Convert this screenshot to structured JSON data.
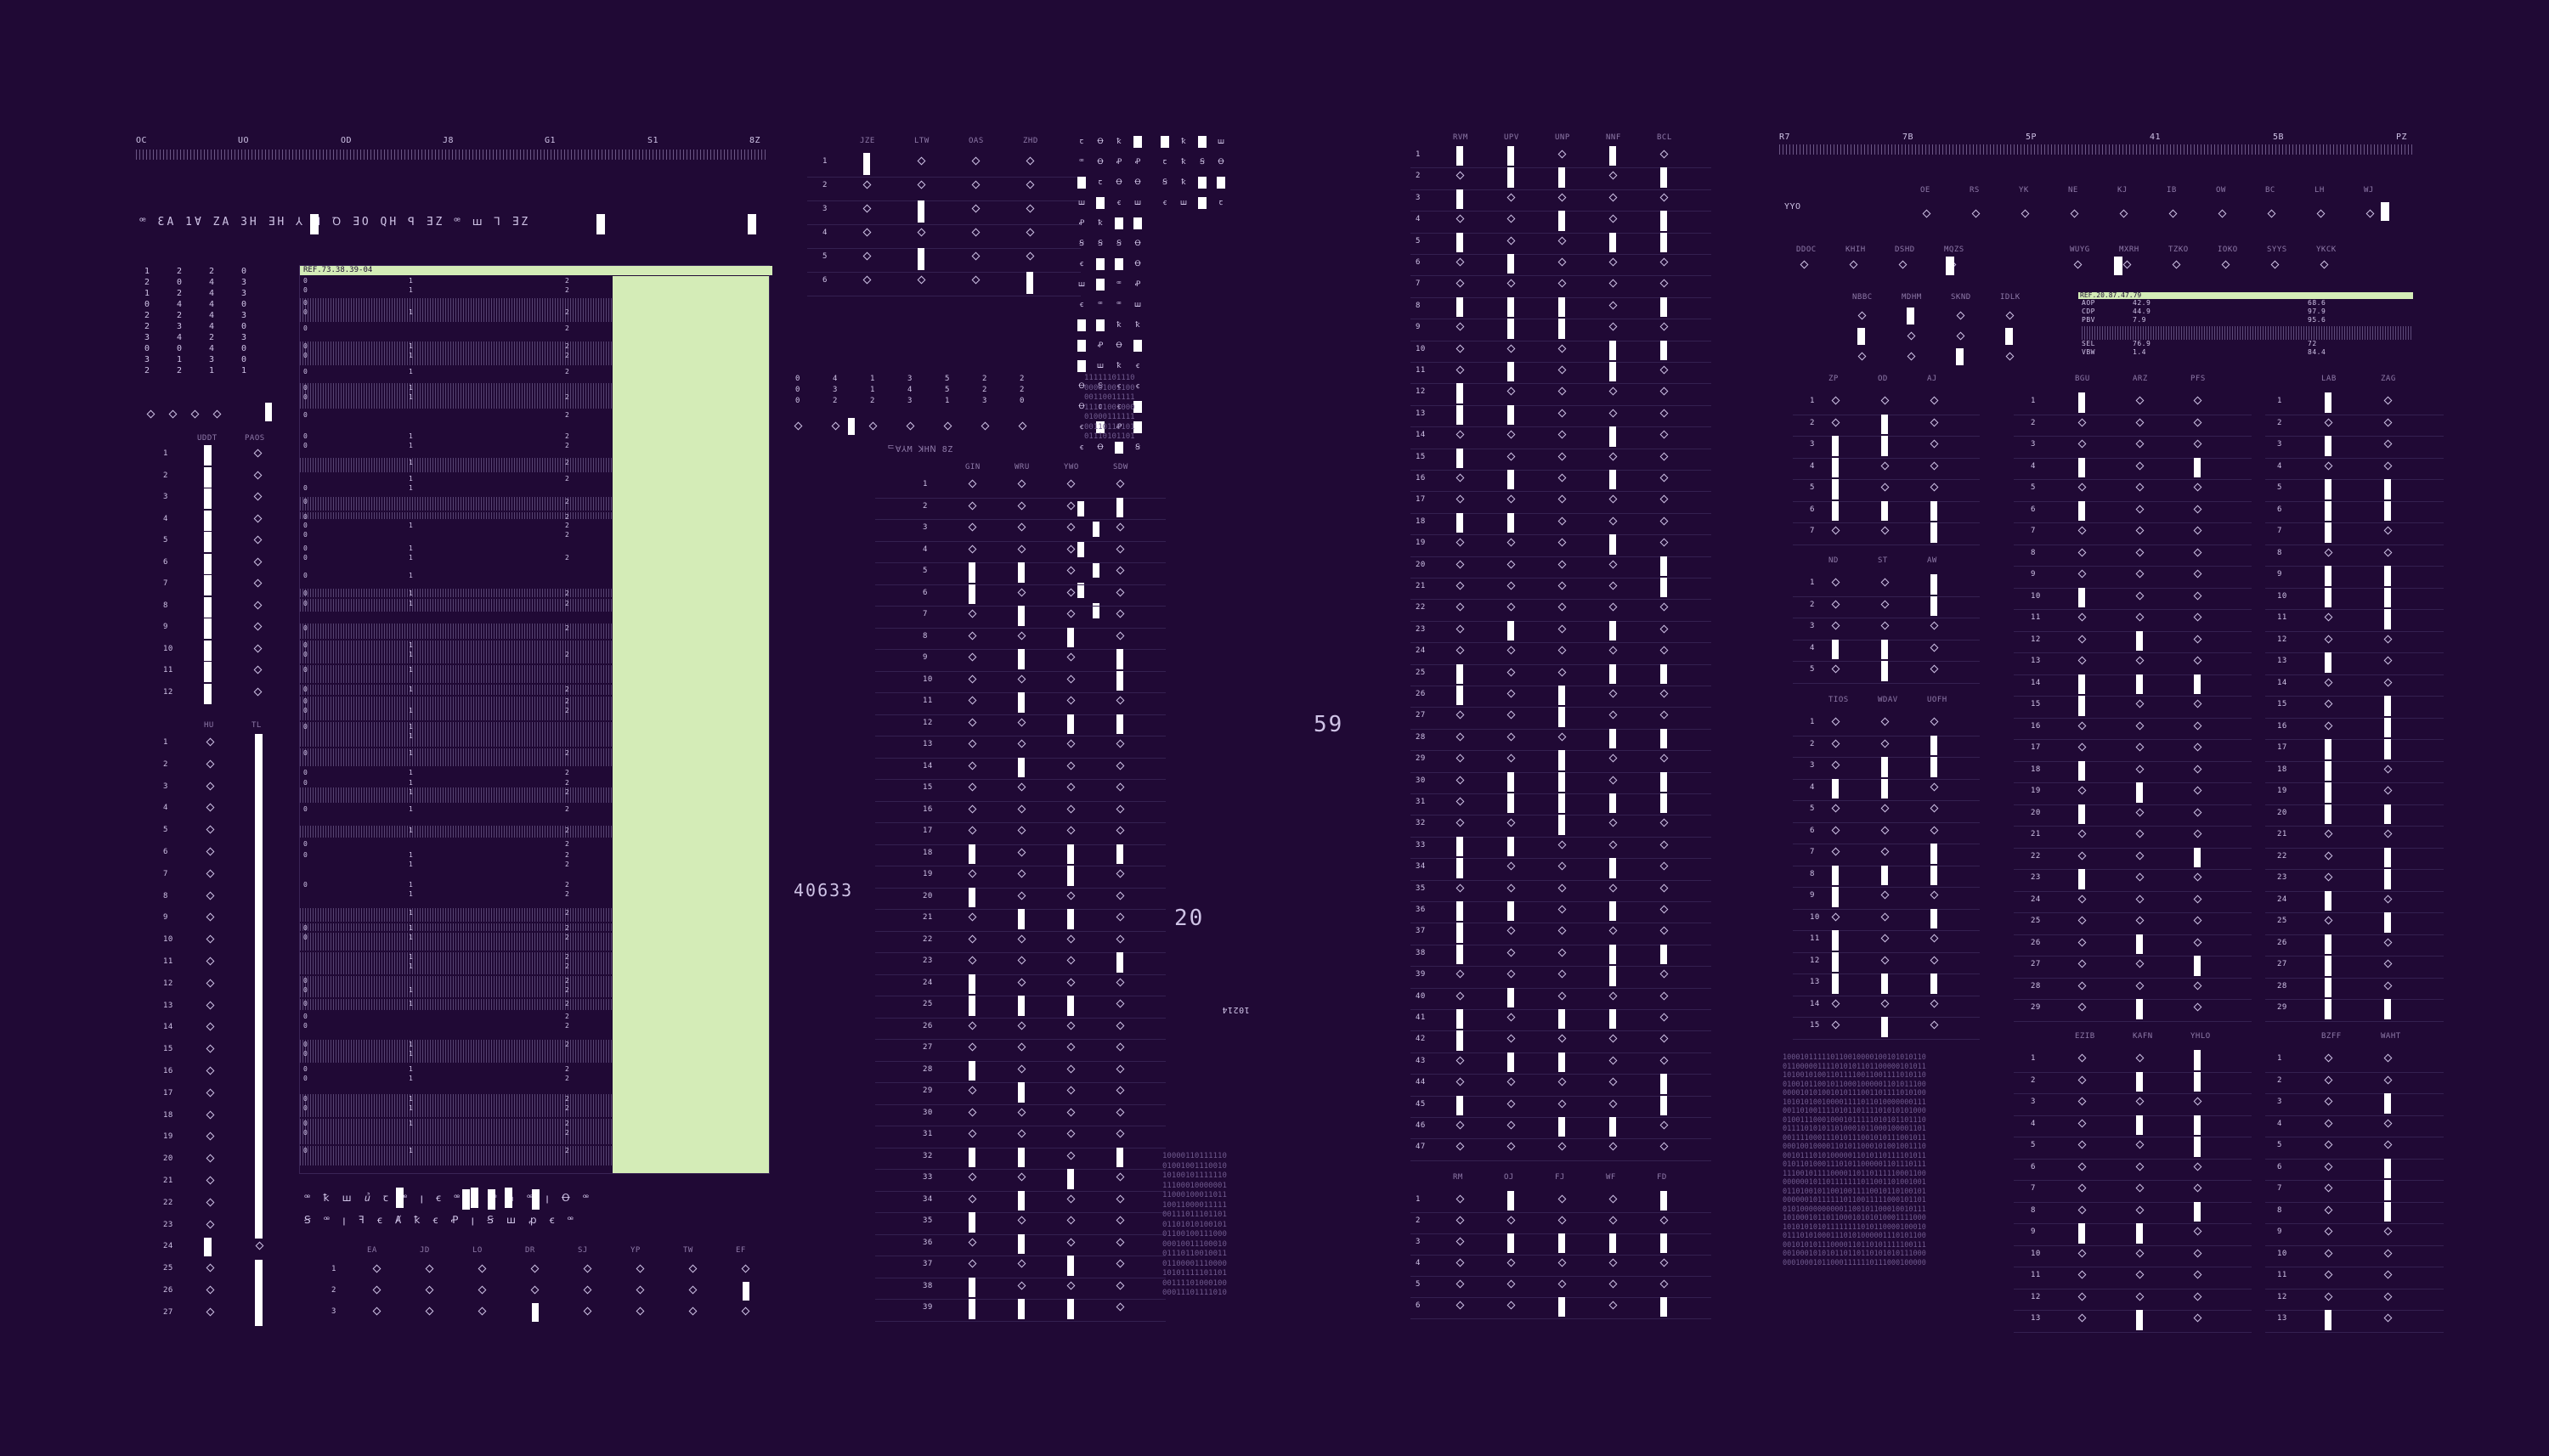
{
  "colors": {
    "background": "#200935",
    "text": "#cfc3e6",
    "accent": "#d4ecb7",
    "bar": "#ffffff",
    "dim": "#8e7aa8"
  },
  "counters": {
    "primary": "59",
    "secondary": "40633",
    "tertiary": "20",
    "small": "10214"
  },
  "top_ruler_left": {
    "labels": [
      "OC",
      "UO",
      "OD",
      "J8",
      "G1",
      "S1",
      "8Z"
    ]
  },
  "top_ruler_right": {
    "labels": [
      "R7",
      "7B",
      "5P",
      "41",
      "5B",
      "PZ"
    ]
  },
  "glyph_strip_top": "ꟹ ƐA 1Ɐ ZA 3H ƎH ⅄ ꟻ Ꝺ ƎO QH ꟼ ƎZ ꟹ ꟺ Ꞁ ƎZ",
  "glyph_strip_bottom_1": "ꟹ ꝁ ꟺ ꞿ ꞇ ꟹ ꞁ ꞓ ꟹ ꞓ ꟹ ꝇ ꟹ ꞁ Ꝋ ꟹ",
  "glyph_strip_bottom_2": "Ꞩ ꟹ ꞁ ꟻ ꞓ Ⱥ ꝁ ꞓ Ꝓ ꞁ Ꞩ ꟺ ꝓ ꞓ ꟹ",
  "matrix_left": {
    "rows": [
      [
        "1",
        "2",
        "2",
        "0"
      ],
      [
        "2",
        "0",
        "4",
        "3"
      ],
      [
        "1",
        "2",
        "4",
        "3"
      ],
      [
        "0",
        "4",
        "4",
        "0"
      ],
      [
        "2",
        "2",
        "4",
        "3"
      ],
      [
        "2",
        "3",
        "4",
        "0"
      ],
      [
        "3",
        "4",
        "2",
        "3"
      ],
      [
        "0",
        "0",
        "4",
        "0"
      ],
      [
        "3",
        "1",
        "3",
        "0"
      ],
      [
        "2",
        "2",
        "1",
        "1"
      ]
    ]
  },
  "panel_left_a": {
    "headers": [
      "UDDT",
      "PAOS"
    ],
    "rows": [
      "1",
      "2",
      "3",
      "4",
      "5",
      "6",
      "7",
      "8",
      "9",
      "10",
      "11",
      "12"
    ]
  },
  "panel_left_b": {
    "headers": [
      "HU",
      "TL"
    ],
    "rows": [
      "1",
      "2",
      "3",
      "4",
      "5",
      "6",
      "7",
      "8",
      "9",
      "10",
      "11",
      "12",
      "13",
      "14",
      "15",
      "16",
      "17",
      "18",
      "19",
      "20",
      "21",
      "22",
      "23",
      "24",
      "25",
      "26",
      "27"
    ]
  },
  "green_panel": {
    "header": "REF.73.38.39-04",
    "col_labels": [
      "0",
      "1",
      "2",
      "3"
    ]
  },
  "table_bottom_left": {
    "headers": [
      "EA",
      "JD",
      "LO",
      "DR",
      "SJ",
      "YP",
      "TW",
      "EF"
    ],
    "rows": [
      "1",
      "2",
      "3"
    ]
  },
  "table_mid_top": {
    "headers": [
      "JZE",
      "LTW",
      "OAS",
      "ZHD"
    ],
    "rows": [
      "1",
      "2",
      "3",
      "4",
      "5",
      "6"
    ]
  },
  "table_mid_main": {
    "headers": [
      "GIN",
      "WRU",
      "YWO",
      "SDW"
    ],
    "label_above": "ᄃꓯ⅄M ꓘHꓠ 8Z",
    "rows": [
      "1",
      "2",
      "3",
      "4",
      "5",
      "6",
      "7",
      "8",
      "9",
      "10",
      "11",
      "12",
      "13",
      "14",
      "15",
      "16",
      "17",
      "18",
      "19",
      "20",
      "21",
      "22",
      "23",
      "24",
      "25",
      "26",
      "27",
      "28",
      "29",
      "30",
      "31",
      "32",
      "33",
      "34",
      "35",
      "36",
      "37",
      "38",
      "39"
    ]
  },
  "mid_matrix": {
    "rows": [
      [
        "0",
        "4",
        "1",
        "3",
        "5",
        "2",
        "2"
      ],
      [
        "0",
        "3",
        "1",
        "4",
        "5",
        "2",
        "2"
      ],
      [
        "0",
        "2",
        "2",
        "3",
        "1",
        "3",
        "0"
      ]
    ]
  },
  "binary_mid": "11111101110\n00001001100\n00110011111\n11101001000\n01000111111\n00110110101\n01110101101",
  "binary_bottom_mid": "10000110111110\n01001001110010\n10100101111110\n11100010000001\n11000100011011\n10011000011111\n00111011101101\n01101010100101\n01100100111000\n00010011100010\n01110110010011\n01100001110000\n10101111101101\n00111101000100\n00011101111010",
  "binary_right": "100010111110110010000100101010110\n011000001111010101101100000101011\n101001010011011110011001111010110\n010010110010110001000001101011100\n000010101001010111001101111010100\n101010100100001111011010000000111\n001101001111010110111101010101000\n010011100010001011111010101101110\n011110101011010001011000100001101\n001111000111010111001010111001011\n000100100001101011000101001001110\n001011101010000011010110111101011\n010110100011101011000001101110111\n111001011110000110110111110001100\n000000101101111111011001101001001\n011010010110010011110010110100101\n000000101111110110011111000101101\n010100000000001100101100010010111\n101000101101100010101010001111000\n101010101011111111010110000100010\n011101010001110101000001110101100\n001010101110000110110101111100111\n001000101010110110110101010111000\n000100010110001111110111000100000",
  "table_right_main": {
    "headers": [
      "RVM",
      "UPV",
      "UNP",
      "NNF",
      "BCL"
    ],
    "rows": [
      "1",
      "2",
      "3",
      "4",
      "5",
      "6",
      "7",
      "8",
      "9",
      "10",
      "11",
      "12",
      "13",
      "14",
      "15",
      "16",
      "17",
      "18",
      "19",
      "20",
      "21",
      "22",
      "23",
      "24",
      "25",
      "26",
      "27",
      "28",
      "29",
      "30",
      "31",
      "32",
      "33",
      "34",
      "35",
      "36",
      "37",
      "38",
      "39",
      "40",
      "41",
      "42",
      "43",
      "44",
      "45",
      "46",
      "47"
    ]
  },
  "table_right_sub": {
    "headers": [
      "RM",
      "OJ",
      "FJ",
      "WF",
      "FD"
    ],
    "rows": [
      "1",
      "2",
      "3",
      "4",
      "5",
      "6"
    ]
  },
  "far_right": {
    "row_label": "YYO",
    "hdr_a": [
      "OE",
      "RS",
      "YK",
      "NE",
      "KJ",
      "IB",
      "OW",
      "BC",
      "LH",
      "WJ"
    ],
    "hdr_b": [
      "DDOC",
      "KHIH",
      "DSHD",
      "MQZS",
      "WUYG",
      "MXRH",
      "TZKO",
      "IOKO",
      "SYYS",
      "YKCK"
    ],
    "hdr_c": [
      "NBBC",
      "MDHM",
      "SKND",
      "IDLK"
    ],
    "info_header": "REF.20.87.47.79",
    "info_rows": [
      [
        "AOP",
        "42.9",
        "68.6"
      ],
      [
        "CDP",
        "44.9",
        "97.9"
      ],
      [
        "PBV",
        "7.9",
        "95.6"
      ],
      [
        "SEL",
        "76.9",
        "72"
      ],
      [
        "VBW",
        "1.4",
        "84.4"
      ]
    ],
    "t1": {
      "headers": [
        "ZP",
        "OD",
        "AJ"
      ],
      "rows": [
        "1",
        "2",
        "3",
        "4",
        "5",
        "6",
        "7"
      ]
    },
    "t2": {
      "headers": [
        "ND",
        "ST",
        "AW"
      ],
      "rows": [
        "1",
        "2",
        "3",
        "4",
        "5"
      ]
    },
    "t3": {
      "headers": [
        "TIOS",
        "WDAV",
        "UOFH"
      ],
      "rows": [
        "1",
        "2",
        "3",
        "4",
        "5",
        "6",
        "7",
        "8",
        "9",
        "10",
        "11",
        "12",
        "13",
        "14",
        "15"
      ]
    },
    "t4": {
      "headers": [
        "BGU",
        "ARZ",
        "PFS"
      ],
      "rows": [
        "1",
        "2",
        "3",
        "4",
        "5",
        "6",
        "7",
        "8",
        "9",
        "10",
        "11",
        "12",
        "13",
        "14",
        "15",
        "16",
        "17",
        "18",
        "19",
        "20",
        "21",
        "22",
        "23",
        "24",
        "25",
        "26",
        "27",
        "28",
        "29"
      ]
    },
    "t5": {
      "headers": [
        "LAB",
        "ZAG"
      ],
      "rows": [
        "1",
        "2",
        "3",
        "4",
        "5",
        "6",
        "7",
        "8",
        "9",
        "10",
        "11",
        "12",
        "13",
        "14",
        "15",
        "16",
        "17",
        "18",
        "19",
        "20",
        "21",
        "22",
        "23",
        "24",
        "25",
        "26",
        "27",
        "28",
        "29"
      ]
    },
    "t6": {
      "headers": [
        "EZIB",
        "KAFN",
        "YHLO"
      ],
      "rows": [
        "1",
        "2",
        "3",
        "4",
        "5",
        "6",
        "7",
        "8",
        "9",
        "10",
        "11",
        "12",
        "13"
      ]
    },
    "t7": {
      "headers": [
        "BZFF",
        "WAHT"
      ],
      "rows": [
        "1",
        "2",
        "3",
        "4",
        "5",
        "6",
        "7",
        "8",
        "9",
        "10",
        "11",
        "12",
        "13"
      ]
    }
  }
}
